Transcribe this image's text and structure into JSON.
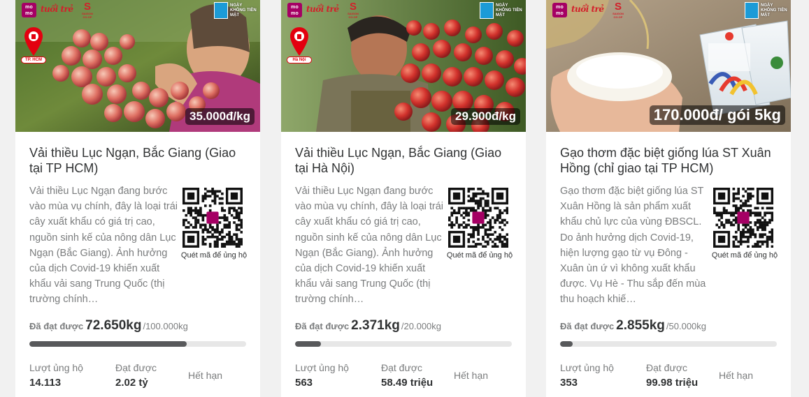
{
  "brand": {
    "momo": "mo mo",
    "tuoitre": "tuổi trẻ",
    "saigon_co_op": "SAIGON CO.OP",
    "ngay_khong_tien_mat": "NGÀY KHÔNG TIỀN MẶT"
  },
  "colors": {
    "momo": "#a50064",
    "accent_red": "#e3000f",
    "progress_fill": "#58595b",
    "progress_track": "#e7e7e7"
  },
  "qr_label": "Quét mã để ủng hộ",
  "achieved_label": "Đã đạt được",
  "stats_labels": {
    "supporters": "Lượt ủng hộ",
    "raised": "Đạt được"
  },
  "cards": [
    {
      "location": "TP. HCM",
      "price": "35.000đ/kg",
      "title": "Vải thiều Lục Ngạn, Bắc Giang (Giao tại TP HCM)",
      "description": "Vải thiều Lục Ngạn đang bước vào mùa vụ chính, đây là loại trái cây xuất khẩu có giá trị cao, nguồn sinh kế của nông dân Lục Ngạn (Bắc Giang). Ảnh hưởng của dịch Covid-19 khiến xuất khẩu vải sang Trung Quốc (thị trường chính…",
      "achieved": "72.650kg",
      "goal": "/100.000kg",
      "progress": 0.7265,
      "supporters": "14.113",
      "raised": "2.02 tỷ",
      "status": "Hết hạn"
    },
    {
      "location": "Hà Nội",
      "price": "29.900đ/kg",
      "title": "Vải thiều Lục Ngạn, Bắc Giang (Giao tại Hà Nội)",
      "description": "Vải thiều Lục Ngạn đang bước vào mùa vụ chính, đây là loại trái cây xuất khẩu có giá trị cao, nguồn sinh kế của nông dân Lục Ngạn (Bắc Giang). Ảnh hưởng của dịch Covid-19 khiến xuất khẩu vải sang Trung Quốc (thị trường chính…",
      "achieved": "2.371kg",
      "goal": "/20.000kg",
      "progress": 0.1186,
      "supporters": "563",
      "raised": "58.49 triệu",
      "status": "Hết hạn"
    },
    {
      "price": "170.000đ/ gói 5kg",
      "package_text": "Gạo Thơm Xuân Hồng",
      "title": "Gạo thơm đặc biệt giống lúa ST Xuân Hồng (chỉ giao tại TP HCM)",
      "description": "Gạo thơm đặc biệt giống lúa ST Xuân Hồng là sản phẩm xuất khẩu chủ lực của vùng ĐBSCL. Do ảnh hưởng dịch Covid-19, hiện lượng gạo từ vụ Đông - Xuân ùn ứ vì không xuất khẩu được. Vụ Hè - Thu sắp đến mùa thu hoạch khiế…",
      "achieved": "2.855kg",
      "goal": "/50.000kg",
      "progress": 0.0571,
      "supporters": "353",
      "raised": "99.98 triệu",
      "status": "Hết hạn"
    }
  ]
}
